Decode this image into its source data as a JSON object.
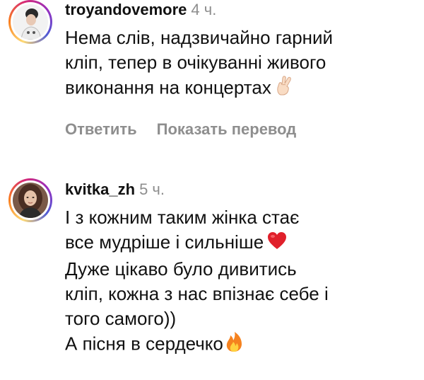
{
  "comments": [
    {
      "username": "troyandovemore",
      "time": "4 ч.",
      "lines": [
        "Нема слів, надзвичайно гарний",
        "кліп, тепер в очікуванні живого",
        "виконання на концертах"
      ],
      "actions": {
        "reply": "Ответить",
        "translate": "Показать перевод"
      }
    },
    {
      "username": "kvitka_zh",
      "time": "5 ч.",
      "lines": [
        "І з кожним таким жінка стає",
        "все мудріше і сильніше",
        "Дуже цікаво було дивитись",
        "кліп, кожна з нас впізнає себе і",
        "того самого))",
        "А пісня в сердечко"
      ]
    }
  ],
  "icons": {
    "crossed_fingers": "crossed-fingers-emoji",
    "heart": "red-heart-emoji",
    "fire": "fire-emoji"
  },
  "colors": {
    "username": "#111111",
    "meta": "#8e8e8e",
    "heart": "#e0202b",
    "fire": "#f5821f"
  }
}
